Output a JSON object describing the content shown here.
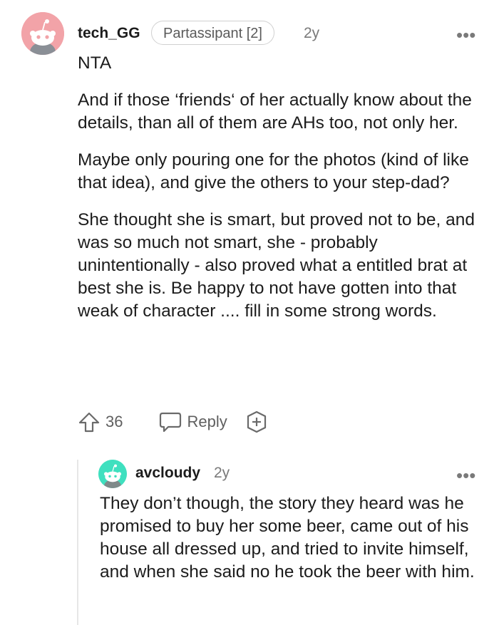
{
  "comment": {
    "username": "tech_GG",
    "flair": "Partassipant [2]",
    "age": "2y",
    "more": "•••",
    "paragraphs": [
      "NTA",
      "And if those ‘friends‘ of her actually know about the details, than all of them are AHs too, not only her.",
      "Maybe only pouring one for the photos (kind of like that idea), and give the others to your step-dad?",
      "She thought she is smart, but proved not to be, and was so much not smart, she - probably unintentionally - also proved what a entitled brat at best she is. Be happy to not have gotten into that weak of character .... fill in some strong words."
    ],
    "upvotes": "36",
    "reply_label": "Reply",
    "icons": [
      "upvote-icon",
      "reply-bubble-icon",
      "award-plus-icon",
      "more-options-icon"
    ]
  },
  "reply": {
    "username": "avcloudy",
    "age": "2y",
    "more": "•••",
    "text": "They don’t though, the story they heard was he promised to buy her some beer, came out of his house all dressed up, and tried to invite himself, and when she said no he took the beer with him."
  },
  "colors": {
    "avatar1_bg": "#f2a3a8",
    "avatar2_bg": "#3fe0bf",
    "text": "#1c1c1c",
    "muted": "#7a7a7a"
  }
}
